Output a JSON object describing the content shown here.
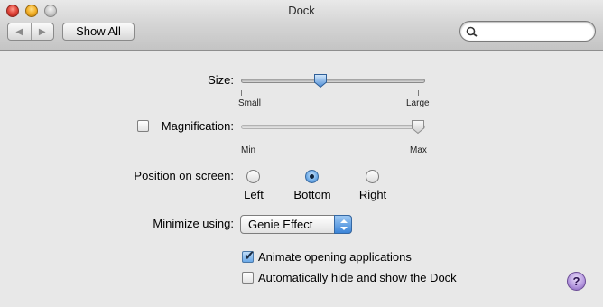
{
  "window": {
    "title": "Dock"
  },
  "toolbar": {
    "back_icon": "left-arrow-icon",
    "forward_icon": "right-arrow-icon",
    "show_all_label": "Show All",
    "search": {
      "value": "",
      "placeholder": ""
    }
  },
  "size": {
    "label": "Size:",
    "min_label": "Small",
    "max_label": "Large",
    "value_fraction": 0.43
  },
  "magnification": {
    "label": "Magnification:",
    "checked": false,
    "min_label": "Min",
    "max_label": "Max",
    "value_fraction": 1.0
  },
  "position": {
    "label": "Position on screen:",
    "options": [
      "Left",
      "Bottom",
      "Right"
    ],
    "selected": "Bottom"
  },
  "minimize": {
    "label": "Minimize using:",
    "selected": "Genie Effect"
  },
  "options": {
    "animate_label": "Animate opening applications",
    "animate_checked": true,
    "autohide_label": "Automatically hide and show the Dock",
    "autohide_checked": false
  },
  "help": {
    "label": "?"
  },
  "colors": {
    "accent": "#3b84d8",
    "background": "#e8e8e8"
  }
}
